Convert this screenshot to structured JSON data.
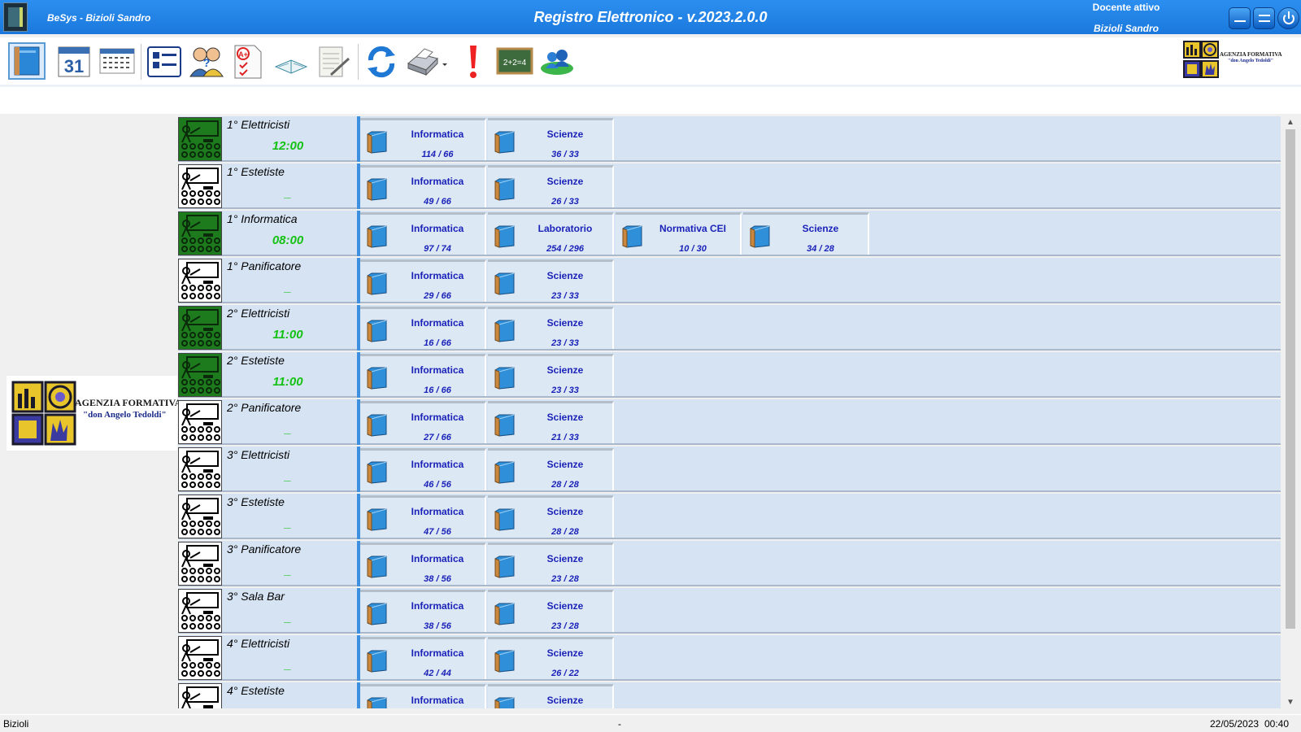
{
  "titlebar": {
    "app_name": "BeSys - Bizioli Sandro",
    "title": "Registro Elettronico - v.2023.2.0.0",
    "teacher_label": "Docente attivo",
    "teacher_name": "Bizioli Sandro"
  },
  "toolbar": {
    "tools": [
      "register-book",
      "calendar",
      "timetable",
      "class-list",
      "students-help",
      "grades",
      "reading",
      "notes",
      "refresh",
      "print",
      "alert",
      "blackboard",
      "users-sync"
    ]
  },
  "logo": {
    "line1": "AGENZIA FORMATIVA",
    "line2": "\"don Angelo Tedoldi\""
  },
  "colors": {
    "titlebar": "#1a78dc",
    "row_bg": "#d6e3f2",
    "subject_text": "#1a22b8",
    "time_text": "#13c213",
    "active_class_icon": "#1d7a1d"
  },
  "classes": [
    {
      "name": "1° Elettricisti",
      "time": "12:00",
      "active": true,
      "subjects": [
        {
          "name": "Informatica",
          "hours": "114 / 66"
        },
        {
          "name": "Scienze",
          "hours": "36 / 33"
        }
      ]
    },
    {
      "name": "1° Estetiste",
      "time": "_",
      "active": false,
      "subjects": [
        {
          "name": "Informatica",
          "hours": "49 / 66"
        },
        {
          "name": "Scienze",
          "hours": "26 / 33"
        }
      ]
    },
    {
      "name": "1° Informatica",
      "time": "08:00",
      "active": true,
      "subjects": [
        {
          "name": "Informatica",
          "hours": "97 / 74"
        },
        {
          "name": "Laboratorio",
          "hours": "254 / 296"
        },
        {
          "name": "Normativa CEI",
          "hours": "10 / 30"
        },
        {
          "name": "Scienze",
          "hours": "34 / 28"
        }
      ]
    },
    {
      "name": "1° Panificatore",
      "time": "_",
      "active": false,
      "subjects": [
        {
          "name": "Informatica",
          "hours": "29 / 66"
        },
        {
          "name": "Scienze",
          "hours": "23 / 33"
        }
      ]
    },
    {
      "name": "2° Elettricisti",
      "time": "11:00",
      "active": true,
      "subjects": [
        {
          "name": "Informatica",
          "hours": "16 / 66"
        },
        {
          "name": "Scienze",
          "hours": "23 / 33"
        }
      ]
    },
    {
      "name": "2° Estetiste",
      "time": "11:00",
      "active": true,
      "subjects": [
        {
          "name": "Informatica",
          "hours": "16 / 66"
        },
        {
          "name": "Scienze",
          "hours": "23 / 33"
        }
      ]
    },
    {
      "name": "2° Panificatore",
      "time": "_",
      "active": false,
      "subjects": [
        {
          "name": "Informatica",
          "hours": "27 / 66"
        },
        {
          "name": "Scienze",
          "hours": "21 / 33"
        }
      ]
    },
    {
      "name": "3° Elettricisti",
      "time": "_",
      "active": false,
      "subjects": [
        {
          "name": "Informatica",
          "hours": "46 / 56"
        },
        {
          "name": "Scienze",
          "hours": "28 / 28"
        }
      ]
    },
    {
      "name": "3° Estetiste",
      "time": "_",
      "active": false,
      "subjects": [
        {
          "name": "Informatica",
          "hours": "47 / 56"
        },
        {
          "name": "Scienze",
          "hours": "28 / 28"
        }
      ]
    },
    {
      "name": "3° Panificatore",
      "time": "_",
      "active": false,
      "subjects": [
        {
          "name": "Informatica",
          "hours": "38 / 56"
        },
        {
          "name": "Scienze",
          "hours": "23 / 28"
        }
      ]
    },
    {
      "name": "3° Sala Bar",
      "time": "_",
      "active": false,
      "subjects": [
        {
          "name": "Informatica",
          "hours": "38 / 56"
        },
        {
          "name": "Scienze",
          "hours": "23 / 28"
        }
      ]
    },
    {
      "name": "4° Elettricisti",
      "time": "_",
      "active": false,
      "subjects": [
        {
          "name": "Informatica",
          "hours": "42 / 44"
        },
        {
          "name": "Scienze",
          "hours": "26 / 22"
        }
      ]
    },
    {
      "name": "4° Estetiste",
      "time": "",
      "active": false,
      "subjects": [
        {
          "name": "Informatica",
          "hours": ""
        },
        {
          "name": "Scienze",
          "hours": ""
        }
      ]
    }
  ],
  "statusbar": {
    "user": "Bizioli",
    "middle": "-",
    "date": "22/05/2023",
    "time": "00:40"
  }
}
